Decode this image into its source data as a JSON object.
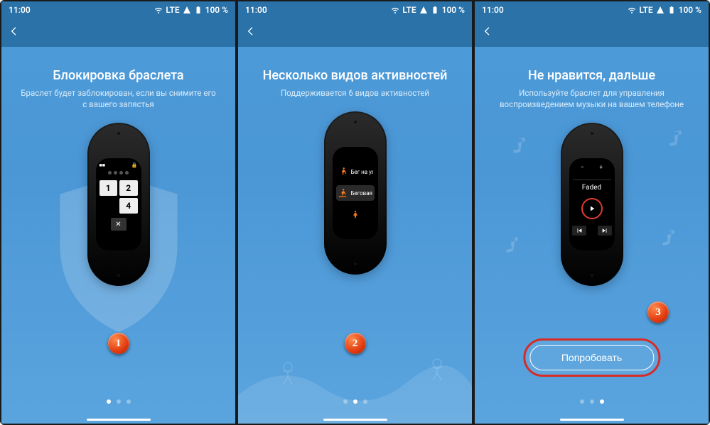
{
  "status": {
    "time": "11:00",
    "net": "LTE",
    "battery": "100 %"
  },
  "screens": [
    {
      "title": "Блокировка браслета",
      "subtitle": "Браслет будет заблокирован, если вы снимите его с вашего запястья",
      "badge": "1",
      "active_dot": 0,
      "keypad": {
        "k1": "1",
        "k2": "2",
        "k4": "4",
        "del": "✕"
      }
    },
    {
      "title": "Несколько видов активностей",
      "subtitle": "Поддерживается 6 видов активностей",
      "badge": "2",
      "active_dot": 1,
      "activities": {
        "a1": "Бег на ули",
        "a2": "Беговая до"
      }
    },
    {
      "title": "Не нравится, дальше",
      "subtitle": "Используйте браслет для управления воспроизведением музыки на вашем телефоне",
      "badge": "3",
      "active_dot": 2,
      "music": {
        "track": "Faded",
        "minus": "−",
        "plus": "+"
      },
      "cta": "Попробовать"
    }
  ]
}
